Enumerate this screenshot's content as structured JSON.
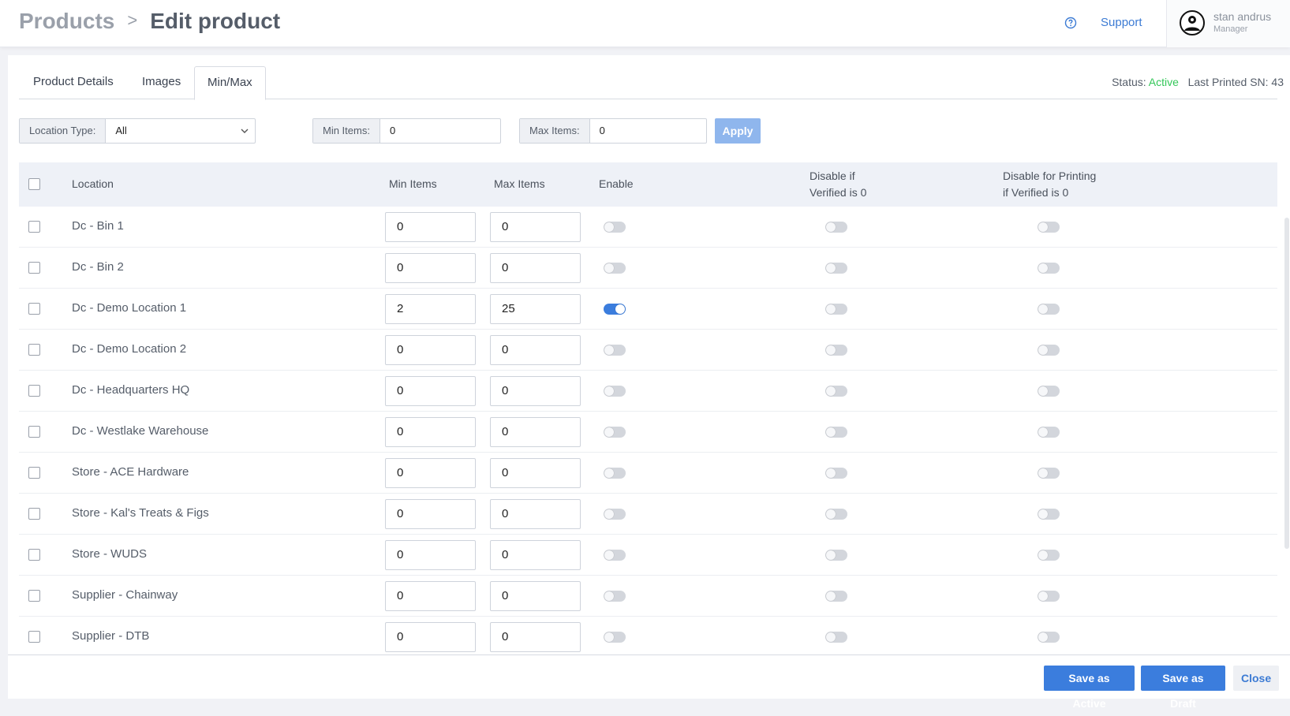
{
  "header": {
    "breadcrumb_root": "Products",
    "breadcrumb_sep": ">",
    "breadcrumb_current": "Edit product",
    "support_label": "Support",
    "user_name": "stan andrus",
    "user_role": "Manager"
  },
  "tabs": [
    {
      "label": "Product Details"
    },
    {
      "label": "Images"
    },
    {
      "label": "Min/Max"
    }
  ],
  "status": {
    "label": "Status:",
    "value": "Active",
    "last_printed": "Last Printed SN: 43"
  },
  "filters": {
    "location_type_label": "Location Type:",
    "location_type_value": "All",
    "min_items_label": "Min Items:",
    "min_items_value": "0",
    "max_items_label": "Max Items:",
    "max_items_value": "0",
    "apply_label": "Apply"
  },
  "table": {
    "headers": {
      "location": "Location",
      "min_items": "Min Items",
      "max_items": "Max Items",
      "enable": "Enable",
      "disable_verified_l1": "Disable if",
      "disable_verified_l2": "Verified is 0",
      "disable_printing_l1": "Disable for Printing",
      "disable_printing_l2": "if Verified is 0"
    },
    "rows": [
      {
        "location": "Dc - Bin 1",
        "min": "0",
        "max": "0",
        "enable": false
      },
      {
        "location": "Dc - Bin 2",
        "min": "0",
        "max": "0",
        "enable": false
      },
      {
        "location": "Dc - Demo Location 1",
        "min": "2",
        "max": "25",
        "enable": true
      },
      {
        "location": "Dc - Demo Location 2",
        "min": "0",
        "max": "0",
        "enable": false
      },
      {
        "location": "Dc - Headquarters HQ",
        "min": "0",
        "max": "0",
        "enable": false
      },
      {
        "location": "Dc - Westlake Warehouse",
        "min": "0",
        "max": "0",
        "enable": false
      },
      {
        "location": "Store - ACE Hardware",
        "min": "0",
        "max": "0",
        "enable": false
      },
      {
        "location": "Store - Kal's Treats & Figs",
        "min": "0",
        "max": "0",
        "enable": false
      },
      {
        "location": "Store - WUDS",
        "min": "0",
        "max": "0",
        "enable": false
      },
      {
        "location": "Supplier - Chainway",
        "min": "0",
        "max": "0",
        "enable": false
      },
      {
        "location": "Supplier - DTB",
        "min": "0",
        "max": "0",
        "enable": false
      }
    ]
  },
  "footer": {
    "save_active": "Save as Active",
    "save_draft": "Save as Draft",
    "close": "Close"
  },
  "colors": {
    "accent": "#3b7ddd",
    "status_active": "#34c759",
    "link": "#3c7bd4"
  },
  "icons": {
    "help": "question-circle-icon",
    "avatar": "user-avatar-icon",
    "dropdown": "chevron-down-icon"
  }
}
